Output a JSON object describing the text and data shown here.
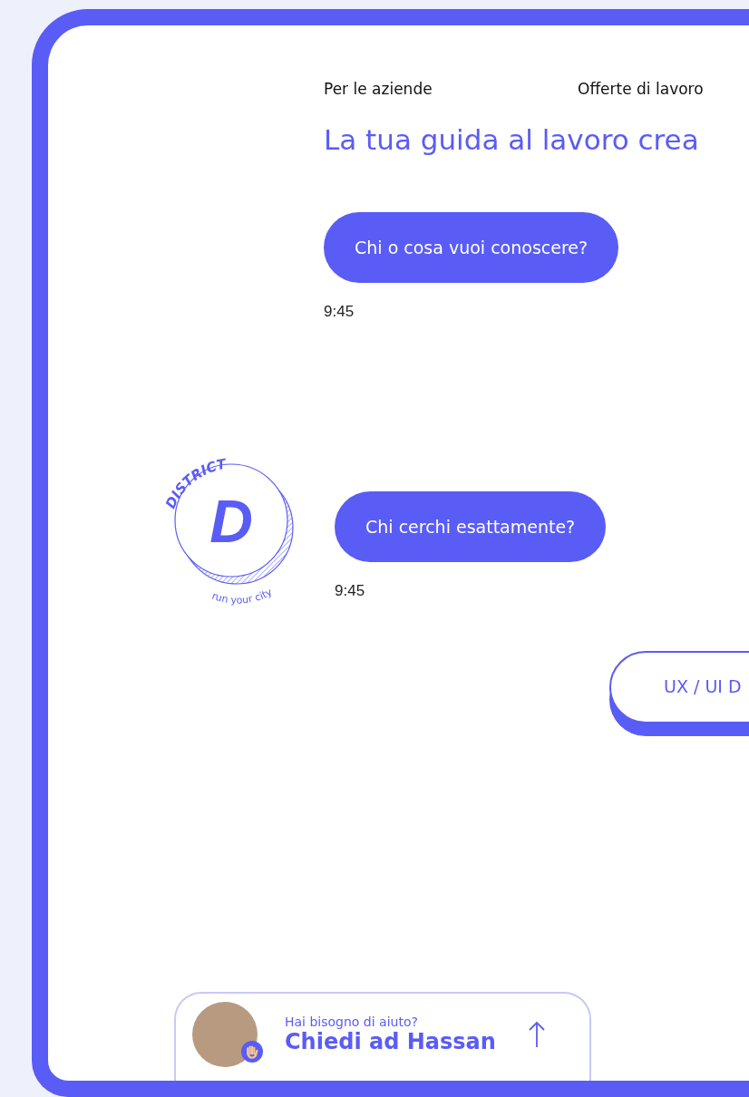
{
  "nav": [
    {
      "label": "Per le aziende"
    },
    {
      "label": "Offerte di lavoro"
    }
  ],
  "heading": "La tua guida al lavoro crea",
  "messages": [
    {
      "text": "Chi o cosa vuoi conoscere?",
      "time": "9:45",
      "with_logo": false
    },
    {
      "text": "Chi cerchi esattamente?",
      "time": "9:45",
      "with_logo": true
    }
  ],
  "logo": {
    "title": "DISTRICT",
    "letter": "D",
    "tagline": "run your city"
  },
  "options": [
    {
      "label": "UX / UI D"
    }
  ],
  "help": {
    "subtitle": "Hai bisogno di aiuto?",
    "title": "Chiedi ad Hassan"
  }
}
